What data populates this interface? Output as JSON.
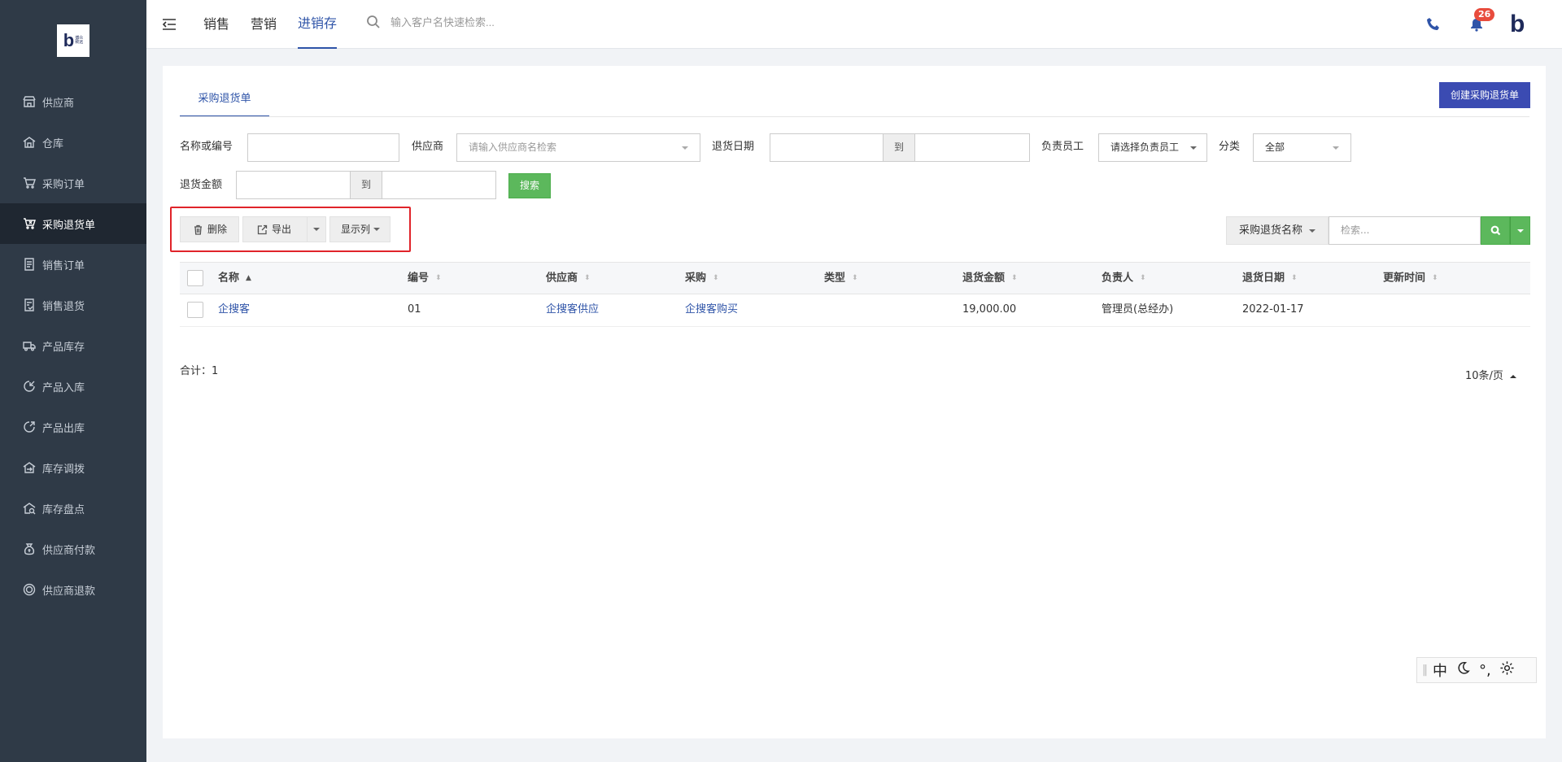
{
  "logo": {
    "mark": "b",
    "text_line1": "博众",
    "text_line2": "致远"
  },
  "sidebar": {
    "items": [
      {
        "label": "供应商",
        "icon": "store-icon"
      },
      {
        "label": "仓库",
        "icon": "warehouse-icon"
      },
      {
        "label": "采购订单",
        "icon": "cart-icon"
      },
      {
        "label": "采购退货单",
        "icon": "cart-return-icon",
        "active": true
      },
      {
        "label": "销售订单",
        "icon": "document-icon"
      },
      {
        "label": "销售退货",
        "icon": "document-return-icon"
      },
      {
        "label": "产品库存",
        "icon": "truck-icon"
      },
      {
        "label": "产品入库",
        "icon": "inbound-icon"
      },
      {
        "label": "产品出库",
        "icon": "outbound-icon"
      },
      {
        "label": "库存调拨",
        "icon": "transfer-icon"
      },
      {
        "label": "库存盘点",
        "icon": "inventory-check-icon"
      },
      {
        "label": "供应商付款",
        "icon": "money-bag-icon"
      },
      {
        "label": "供应商退款",
        "icon": "refund-icon"
      }
    ]
  },
  "header": {
    "nav": [
      "销售",
      "营销",
      "进销存"
    ],
    "active_nav": "进销存",
    "search_placeholder": "输入客户名快速检索...",
    "notification_count": "26",
    "brand_mark": "b"
  },
  "page": {
    "tab": "采购退货单",
    "create_button": "创建采购退货单",
    "filters": {
      "name_label": "名称或编号",
      "supplier_label": "供应商",
      "supplier_placeholder": "请输入供应商名检索",
      "date_label": "退货日期",
      "to": "到",
      "owner_label": "负责员工",
      "owner_placeholder": "请选择负责员工",
      "category_label": "分类",
      "category_value": "全部",
      "amount_label": "退货金额",
      "search_button": "搜索"
    },
    "toolbar": {
      "delete": "删除",
      "export": "导出",
      "columns": "显示列",
      "search_field": "采购退货名称",
      "search_placeholder": "检索..."
    },
    "table": {
      "columns": [
        "名称",
        "编号",
        "供应商",
        "采购",
        "类型",
        "退货金额",
        "负责人",
        "退货日期",
        "更新时间"
      ],
      "rows": [
        {
          "name": "企搜客",
          "code": "01",
          "supplier": "企搜客供应",
          "purchase": "企搜客购买",
          "type": "",
          "amount": "19,000.00",
          "owner": "管理员(总经办)",
          "date": "2022-01-17",
          "updated": ""
        }
      ]
    },
    "total": "合计：1",
    "page_size": "10条/页"
  },
  "ime": {
    "lang": "中",
    "punct": "°,"
  },
  "colors": {
    "sidebar_bg": "#2f3a47",
    "accent": "#2f54a8",
    "create_btn": "#3b4bb2",
    "success": "#5cb85c",
    "highlight": "#e0242a",
    "badge": "#e84c3d"
  }
}
